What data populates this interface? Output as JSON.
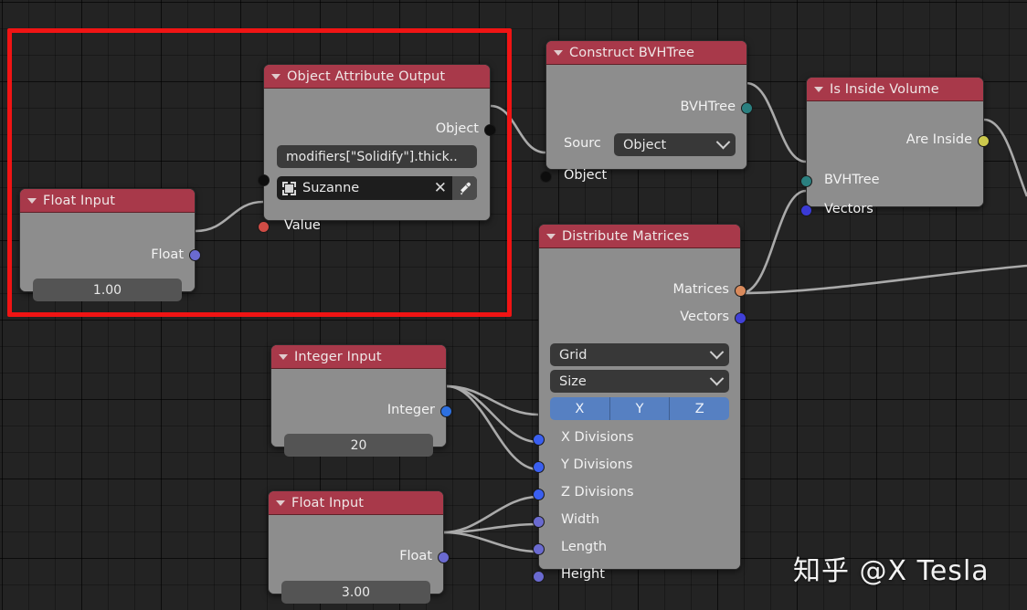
{
  "app": {
    "editor": "Blender Geometry Node Editor"
  },
  "watermark": {
    "text": "知乎 @X Tesla"
  },
  "selection": {
    "color": "#f01414",
    "label": "selection-rectangle"
  },
  "colors": {
    "header_red": "#a8394a",
    "node_body": "#8d8d8d",
    "socket_float": "#6a6ad0",
    "socket_int": "#2d70e0",
    "socket_object": "#0d0d0d",
    "socket_value_red": "#cf4c45",
    "socket_bvhtree": "#2a7f7f",
    "socket_boolean": "#ccc94d",
    "socket_matrix": "#d98a5c",
    "xyz_blue": "#5680c2",
    "background": "#232323"
  },
  "nodes": [
    {
      "id": "float-input-1",
      "title": "Float Input",
      "outputs": [
        {
          "label": "Float",
          "color": "#6a6ad0"
        }
      ],
      "inputs": [],
      "value_field": "1.00"
    },
    {
      "id": "object-attribute-output",
      "title": "Object Attribute Output",
      "outputs": [
        {
          "label": "Object",
          "color": "#0d0d0d"
        }
      ],
      "inputs": [
        {
          "label": "",
          "color": "#0d0d0d"
        },
        {
          "label": "Value",
          "color": "#cf4c45"
        }
      ],
      "path_field": "modifiers[\"Solidify\"].thick..",
      "object_field": {
        "name": "Suzanne",
        "clear": "✕",
        "eyedropper": "eyedropper-icon"
      }
    },
    {
      "id": "construct-bvhtree",
      "title": "Construct BVHTree",
      "outputs": [
        {
          "label": "BVHTree",
          "color": "#2a7f7f"
        }
      ],
      "inputs": [
        {
          "label": "Object",
          "color": "#0d0d0d"
        }
      ],
      "source_label": "Sourc",
      "source_value": "Object"
    },
    {
      "id": "is-inside-volume",
      "title": "Is Inside Volume",
      "outputs": [
        {
          "label": "Are Inside",
          "color": "#ccc94d"
        }
      ],
      "inputs": [
        {
          "label": "BVHTree",
          "color": "#2a7f7f"
        },
        {
          "label": "Vectors",
          "color": "#3a3ad6"
        }
      ]
    },
    {
      "id": "distribute-matrices",
      "title": "Distribute Matrices",
      "outputs": [
        {
          "label": "Matrices",
          "color": "#d98a5c"
        },
        {
          "label": "Vectors",
          "color": "#4040d8"
        }
      ],
      "mode_dropdown": "Grid",
      "size_dropdown": "Size",
      "axis_buttons": [
        "X",
        "Y",
        "Z"
      ],
      "inputs": [
        {
          "label": "X Divisions",
          "color": "#3a5ff0"
        },
        {
          "label": "Y Divisions",
          "color": "#3a5ff0"
        },
        {
          "label": "Z Divisions",
          "color": "#3a5ff0"
        },
        {
          "label": "Width",
          "color": "#6a6ad0"
        },
        {
          "label": "Length",
          "color": "#6a6ad0"
        },
        {
          "label": "Height",
          "color": "#6a6ad0"
        }
      ]
    },
    {
      "id": "integer-input",
      "title": "Integer Input",
      "outputs": [
        {
          "label": "Integer",
          "color": "#2d70e0"
        }
      ],
      "inputs": [],
      "value_field": "20"
    },
    {
      "id": "float-input-2",
      "title": "Float Input",
      "outputs": [
        {
          "label": "Float",
          "color": "#6a6ad0"
        }
      ],
      "inputs": [],
      "value_field": "3.00"
    }
  ]
}
